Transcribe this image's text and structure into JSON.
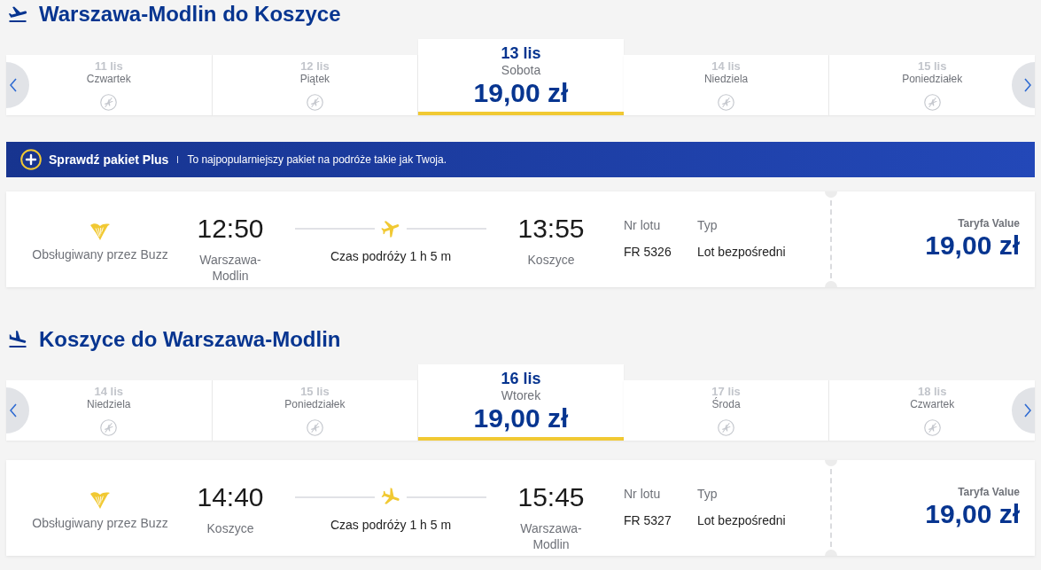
{
  "journeys": [
    {
      "kind": "departure",
      "title": "Warszawa-Modlin do Koszyce",
      "dates": [
        {
          "date": "11 lis",
          "day": "Czwartek",
          "selected": false
        },
        {
          "date": "12 lis",
          "day": "Piątek",
          "selected": false
        },
        {
          "date": "13 lis",
          "day": "Sobota",
          "selected": true,
          "price": "19,00 zł"
        },
        {
          "date": "14 lis",
          "day": "Niedziela",
          "selected": false
        },
        {
          "date": "15 lis",
          "day": "Poniedziałek",
          "selected": false
        }
      ],
      "promo_banner": {
        "title": "Sprawdź pakiet Plus",
        "text": "To najpopularniejszy pakiet na podróże takie jak Twoja."
      },
      "flight": {
        "operator": "Obsługiwany przez Buzz",
        "departure_time": "12:50",
        "departure_city": "Warszawa-Modlin",
        "duration": "Czas podróży 1 h 5 m",
        "arrival_time": "13:55",
        "arrival_city": "Koszyce",
        "flight_number_label": "Nr lotu",
        "flight_number": "FR 5326",
        "type_label": "Typ",
        "type": "Lot bezpośredni",
        "fare_label": "Taryfa Value",
        "price": "19,00 zł"
      }
    },
    {
      "kind": "arrival",
      "title": "Koszyce do Warszawa-Modlin",
      "dates": [
        {
          "date": "14 lis",
          "day": "Niedziela",
          "selected": false
        },
        {
          "date": "15 lis",
          "day": "Poniedziałek",
          "selected": false
        },
        {
          "date": "16 lis",
          "day": "Wtorek",
          "selected": true,
          "price": "19,00 zł"
        },
        {
          "date": "17 lis",
          "day": "Środa",
          "selected": false
        },
        {
          "date": "18 lis",
          "day": "Czwartek",
          "selected": false
        }
      ],
      "flight": {
        "operator": "Obsługiwany przez Buzz",
        "departure_time": "14:40",
        "departure_city": "Koszyce",
        "duration": "Czas podróży 1 h 5 m",
        "arrival_time": "15:45",
        "arrival_city": "Warszawa-Modlin",
        "flight_number_label": "Nr lotu",
        "flight_number": "FR 5327",
        "type_label": "Typ",
        "type": "Lot bezpośredni",
        "fare_label": "Taryfa Value",
        "price": "19,00 zł"
      }
    }
  ]
}
